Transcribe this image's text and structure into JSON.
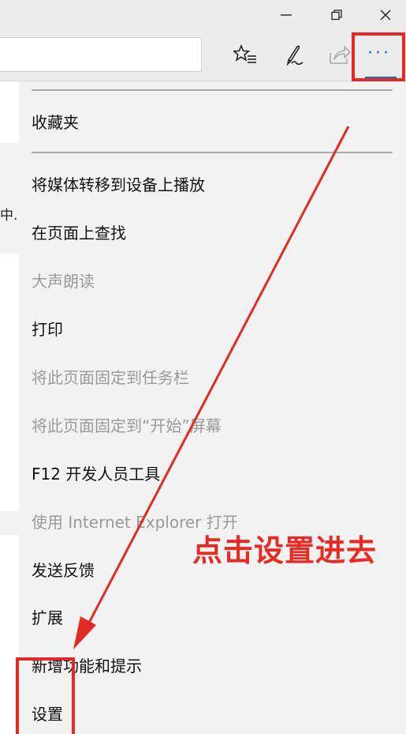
{
  "window": {
    "minimize_icon": "minimize-icon",
    "restore_icon": "restore-icon",
    "close_icon": "close-icon"
  },
  "toolbar": {
    "address_value": "",
    "favorites_icon": "star-list-icon",
    "notes_icon": "pen-icon",
    "share_icon": "share-icon",
    "more_label": "···",
    "accent": "#0a6fd6"
  },
  "page_behind": {
    "visible_fragment": "中."
  },
  "menu": {
    "favorites": "收藏夹",
    "items": [
      {
        "label": "将媒体转移到设备上播放",
        "enabled": true
      },
      {
        "label": "在页面上查找",
        "enabled": true
      },
      {
        "label": "大声朗读",
        "enabled": false
      },
      {
        "label": "打印",
        "enabled": true
      },
      {
        "label": "将此页面固定到任务栏",
        "enabled": false
      },
      {
        "label": "将此页面固定到“开始”屏幕",
        "enabled": false
      },
      {
        "label": "F12 开发人员工具",
        "enabled": true
      },
      {
        "label": "使用 Internet Explorer 打开",
        "enabled": false
      },
      {
        "label": "发送反馈",
        "enabled": true
      },
      {
        "label": "扩展",
        "enabled": true
      },
      {
        "label": "新增功能和提示",
        "enabled": true
      },
      {
        "label": "设置",
        "enabled": true
      }
    ]
  },
  "annotation": {
    "text": "点击设置进去",
    "color": "#e32b26"
  }
}
